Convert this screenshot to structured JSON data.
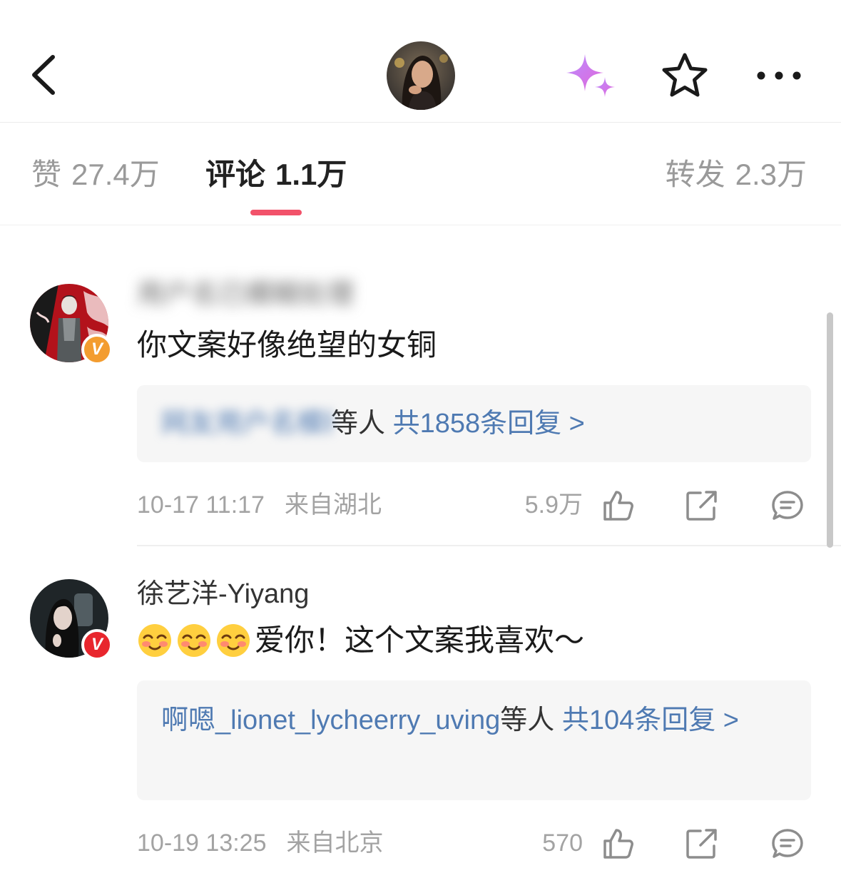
{
  "tabs": {
    "likes_label": "赞",
    "likes_count": "27.4万",
    "comments_label": "评论",
    "comments_count": "1.1万",
    "reposts_label": "转发",
    "reposts_count": "2.3万"
  },
  "colors": {
    "accent": "#f2526a",
    "link": "#4f7ab2",
    "vip_orange": "#f39c2f",
    "vip_red": "#e8262d"
  },
  "icons": {
    "back": "chevron-left-icon",
    "ai": "sparkle-icon",
    "favorite": "star-outline-icon",
    "more": "more-horizontal-icon",
    "like": "thumbs-up-icon",
    "share": "share-icon",
    "reply": "comment-icon"
  },
  "comments": [
    {
      "username": "用户名已模糊处理",
      "badge": "V",
      "text": "你文案好像绝望的女铜",
      "reply_users": "网友用户名模糊",
      "reply_suffix": "等人",
      "reply_total": "共1858条回复 >",
      "time": "10-17 11:17",
      "location": "来自湖北",
      "likes": "5.9万"
    },
    {
      "username": "徐艺洋-Yiyang",
      "badge": "V",
      "text": "爱你！这个文案我喜欢～",
      "emoji": "blushing-face-emoji",
      "reply_users": "啊嗯_lionet_lycheerry_uving",
      "reply_suffix": "等人",
      "reply_total": "共104条回复 >",
      "time": "10-19 13:25",
      "location": "来自北京",
      "likes": "570"
    }
  ]
}
